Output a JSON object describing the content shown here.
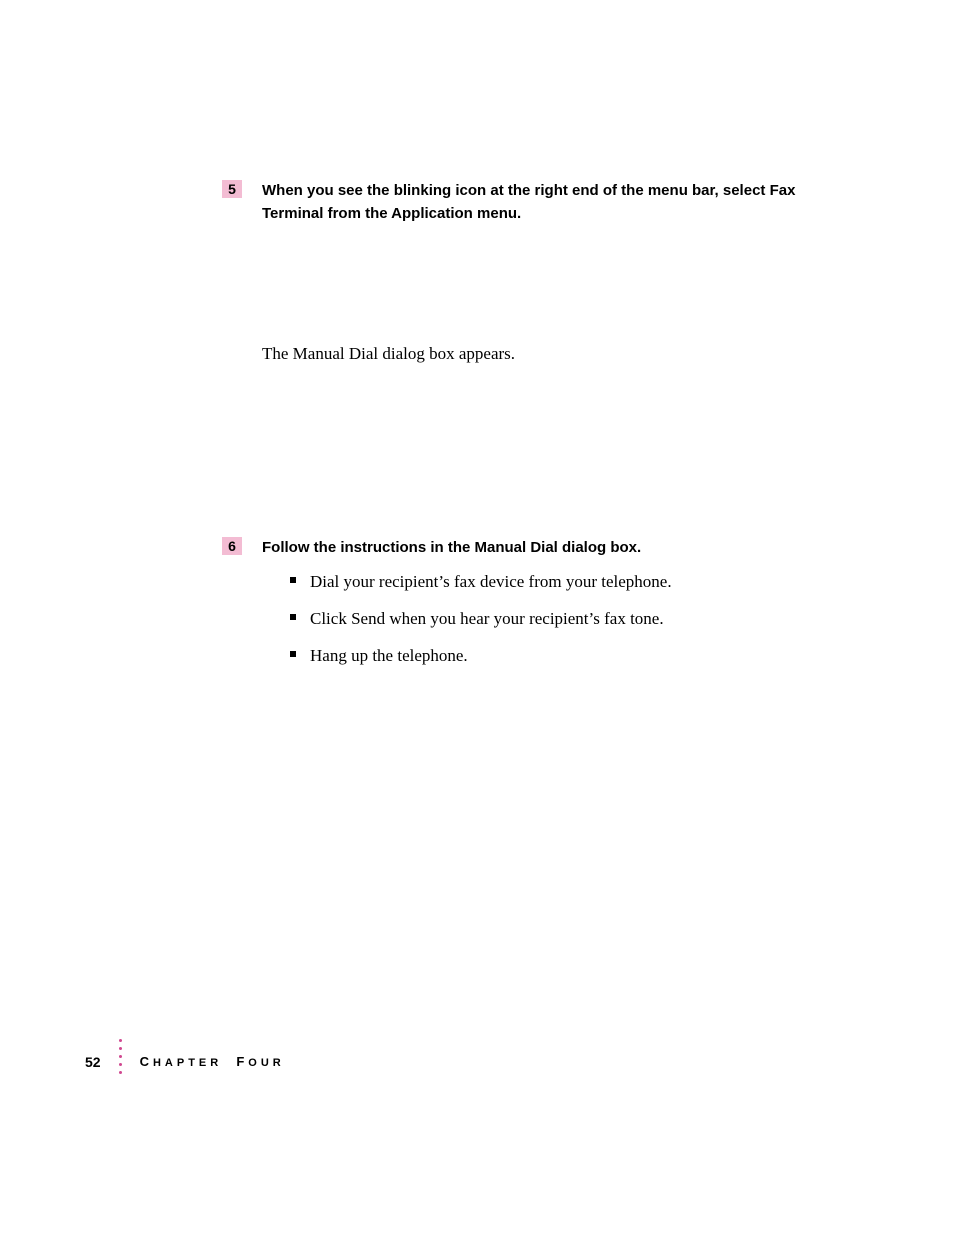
{
  "step5": {
    "number": "5",
    "text": "When you see the blinking icon at the right end of the menu bar, select Fax Terminal from the Application menu."
  },
  "body": "The Manual Dial dialog box appears.",
  "step6": {
    "number": "6",
    "text": "Follow the instructions in the Manual Dial dialog box."
  },
  "bullets": [
    "Dial your recipient’s fax device from your telephone.",
    "Click Send when you hear your recipient’s fax tone.",
    "Hang up the telephone."
  ],
  "footer": {
    "page": "52",
    "chapter_c": "C",
    "chapter_hapter": "HAPTER",
    "chapter_f": "F",
    "chapter_our": "OUR"
  }
}
